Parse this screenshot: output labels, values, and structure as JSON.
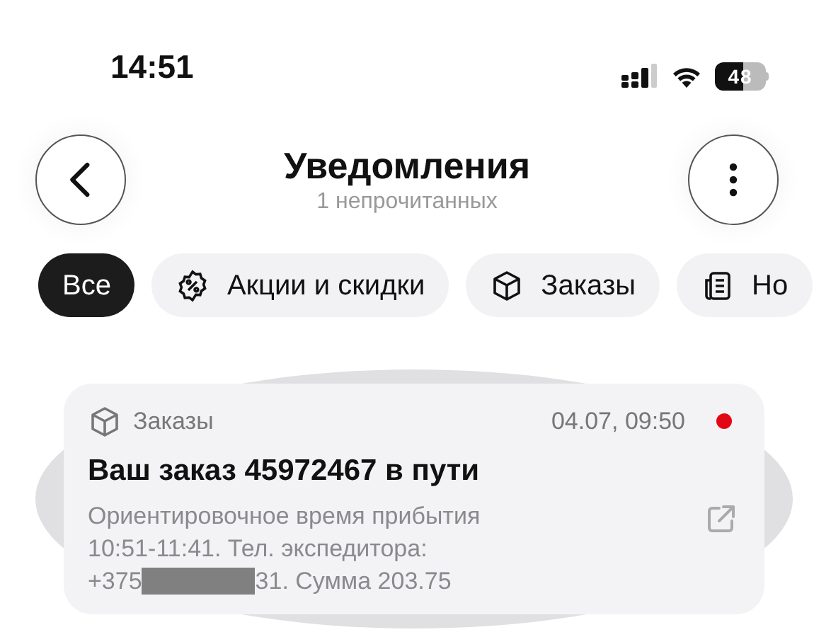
{
  "status_bar": {
    "time": "14:51",
    "battery": "48"
  },
  "header": {
    "title": "Уведомления",
    "subtitle": "1 непрочитанных"
  },
  "filters": [
    {
      "label": "Все",
      "kind": "plain",
      "selected": true
    },
    {
      "label": "Акции и скидки",
      "kind": "discount",
      "selected": false
    },
    {
      "label": "Заказы",
      "kind": "box",
      "selected": false
    },
    {
      "label": "Но",
      "kind": "document",
      "selected": false
    }
  ],
  "notifications": [
    {
      "category": "Заказы",
      "time": "04.07, 09:50",
      "unread": true,
      "title": "Ваш заказ 45972467 в пути",
      "body_lines": [
        "Ориентировочное время прибытия",
        "10:51-11:41. Тел. экспедитора:"
      ],
      "body_before": "+375",
      "body_after": "31. Сумма 203.75"
    }
  ]
}
